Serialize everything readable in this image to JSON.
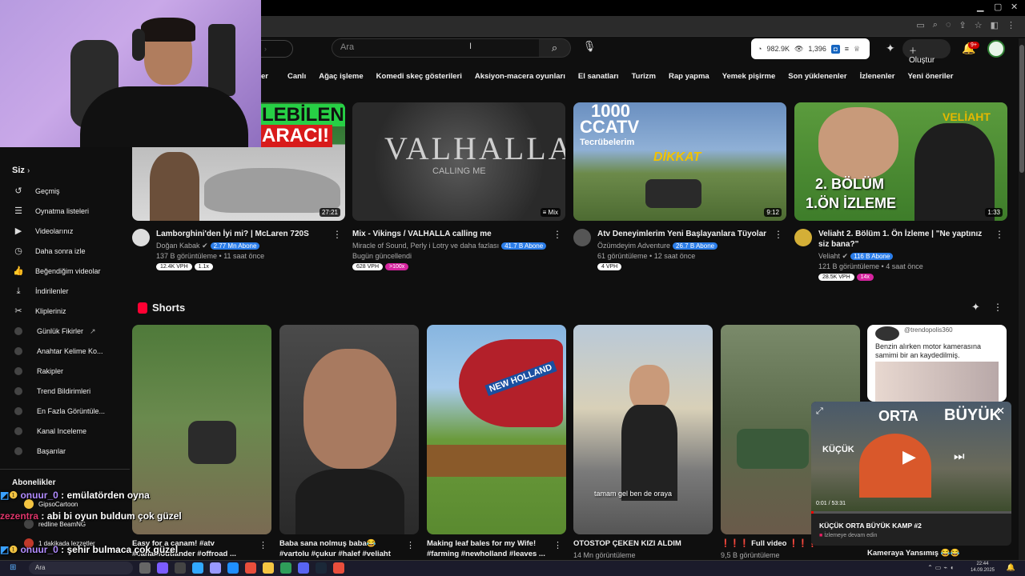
{
  "header": {
    "search_placeholder": "Ara",
    "search_icon": "search-icon",
    "mic_icon": "mic-icon",
    "stats": {
      "likes": "982.9K",
      "views": "1,396"
    },
    "create_label": "Oluştur",
    "notif_count": "9+"
  },
  "chips": [
    "er",
    "Canlı",
    "Ağaç işleme",
    "Komedi skeç gösterileri",
    "Aksiyon-macera oyunları",
    "El sanatları",
    "Turizm",
    "Rap yapma",
    "Yemek pişirme",
    "Son yüklenenler",
    "İzlenenler",
    "Yeni öneriler"
  ],
  "sidebar": {
    "you_title": "Siz",
    "items": [
      {
        "label": "Geçmiş",
        "icon": "history-icon"
      },
      {
        "label": "Oynatma listeleri",
        "icon": "playlist-icon"
      },
      {
        "label": "Videolarınız",
        "icon": "video-icon"
      },
      {
        "label": "Daha sonra izle",
        "icon": "clock-icon"
      },
      {
        "label": "Beğendiğim videolar",
        "icon": "thumbs-up-icon"
      },
      {
        "label": "İndirilenler",
        "icon": "download-icon"
      },
      {
        "label": "Klipleriniz",
        "icon": "scissors-icon"
      },
      {
        "label": "Günlük Fikirler",
        "icon": "extension-icon"
      },
      {
        "label": "Anahtar Kelime Ko...",
        "icon": "extension-icon"
      },
      {
        "label": "Rakipler",
        "icon": "extension-icon"
      },
      {
        "label": "Trend Bildirimleri",
        "icon": "extension-icon"
      },
      {
        "label": "En Fazla Görüntüle...",
        "icon": "extension-icon"
      },
      {
        "label": "Kanal Inceleme",
        "icon": "extension-icon"
      },
      {
        "label": "Başarılar",
        "icon": "extension-icon"
      }
    ],
    "subs_title": "Abonelikler",
    "subs": [
      {
        "label": "GipsoCartoon"
      },
      {
        "label": "redline BeamNG"
      },
      {
        "label": "1 dakikada lezzetler"
      }
    ]
  },
  "videos": [
    {
      "title": "Lamborghini'den İyi mi? | McLaren 720S",
      "channel": "Doğan Kabak",
      "subs": "2.77 Mn Abone",
      "meta": "137 B görüntüleme • 11 saat önce",
      "duration": "27:21",
      "thumb_text_1": "LEBİLEN",
      "thumb_text_2": "ARACI!",
      "pills": [
        {
          "text": "12.4K VPH",
          "kind": "w"
        },
        {
          "text": "1.1x",
          "kind": "w"
        }
      ]
    },
    {
      "title": "Mix - Vikings / VALHALLA calling me",
      "channel": "Miracle of Sound, Perly i Lotry ve daha fazlası",
      "subs": "41.7 B Abone",
      "meta": "Bugün güncellendi",
      "duration": "Mix",
      "thumb_text_1": "VALHALLA",
      "thumb_text_2": "CALLING ME",
      "pills": [
        {
          "text": "628 VPH",
          "kind": "w"
        },
        {
          "text": ">100x",
          "kind": "m"
        }
      ]
    },
    {
      "title": "Atv Deneyimlerim Yeni Başlayanlara Tüyolar",
      "channel": "Özümdeyim Adventure",
      "subs": "26.7 B Abone",
      "meta": "61 görüntüleme • 12 saat önce",
      "duration": "9:12",
      "thumb_text_1": "1000",
      "thumb_text_2": "CCATV",
      "thumb_text_3": "Tecrübelerim",
      "thumb_text_4": "DİKKAT",
      "pills": [
        {
          "text": "4 VPH",
          "kind": "w"
        }
      ]
    },
    {
      "title": "Veliaht 2. Bölüm 1. Ön İzleme | \"Ne yaptınız siz bana?\"",
      "channel": "Veliaht",
      "subs": "116 B Abone",
      "meta": "121 B görüntüleme • 4 saat önce",
      "duration": "1:33",
      "thumb_text_1": "VELİAHT",
      "thumb_text_2": "2. BÖLÜM",
      "thumb_text_3": "1.ÖN İZLEME",
      "pills": [
        {
          "text": "28.5K VPH",
          "kind": "w"
        },
        {
          "text": "14x",
          "kind": "m"
        }
      ]
    }
  ],
  "shorts": {
    "title": "Shorts",
    "items": [
      {
        "title": "Easy for a canam! #atv #canamoutlander #offroad ...",
        "views": ""
      },
      {
        "title": "Baba sana nolmuş baba😂 #vartolu #çukur #halef #veliaht",
        "views": ""
      },
      {
        "title": "Making leaf bales for my Wife! #farming #newholland #leaves ...",
        "views": "",
        "thumb_text": "NEW HOLLAND"
      },
      {
        "title": "OTOSTOP ÇEKEN KIZI ALDIM",
        "views": "14 Mn görüntüleme",
        "thumb_text": "tamam gel ben de oraya"
      },
      {
        "title": "❗❗❗ Full video ❗❗❗",
        "views": "9,5 B görüntüleme"
      },
      {
        "title": "Kameraya Yansımış 😂😂",
        "views": "",
        "tweet_user": "@trendopolis360",
        "tweet_text": "Benzin alırken motor kamerasına samimi bir an kaydedilmiş."
      }
    ]
  },
  "miniplayer": {
    "title": "KÜÇÜK ORTA BÜYÜK KAMP #2",
    "time": "0:01 / 53:31",
    "continue_label": "İzlemeye devam edin",
    "thumb_text_1": "KÜÇÜK",
    "thumb_text_2": "ORTA",
    "thumb_text_3": "BÜYÜK",
    "progress": 0.01
  },
  "chat": [
    {
      "user": "onuur_0",
      "msg": "emülatörden oyna"
    },
    {
      "user": "zezentra",
      "msg": "abi bi oyun buldum çok güzel"
    },
    {
      "user": "onuur_0",
      "msg": "şehir bulmaca çok güzel"
    }
  ],
  "taskbar": {
    "search_placeholder": "Ara",
    "time": "22:44",
    "date": "14.09.2025"
  }
}
